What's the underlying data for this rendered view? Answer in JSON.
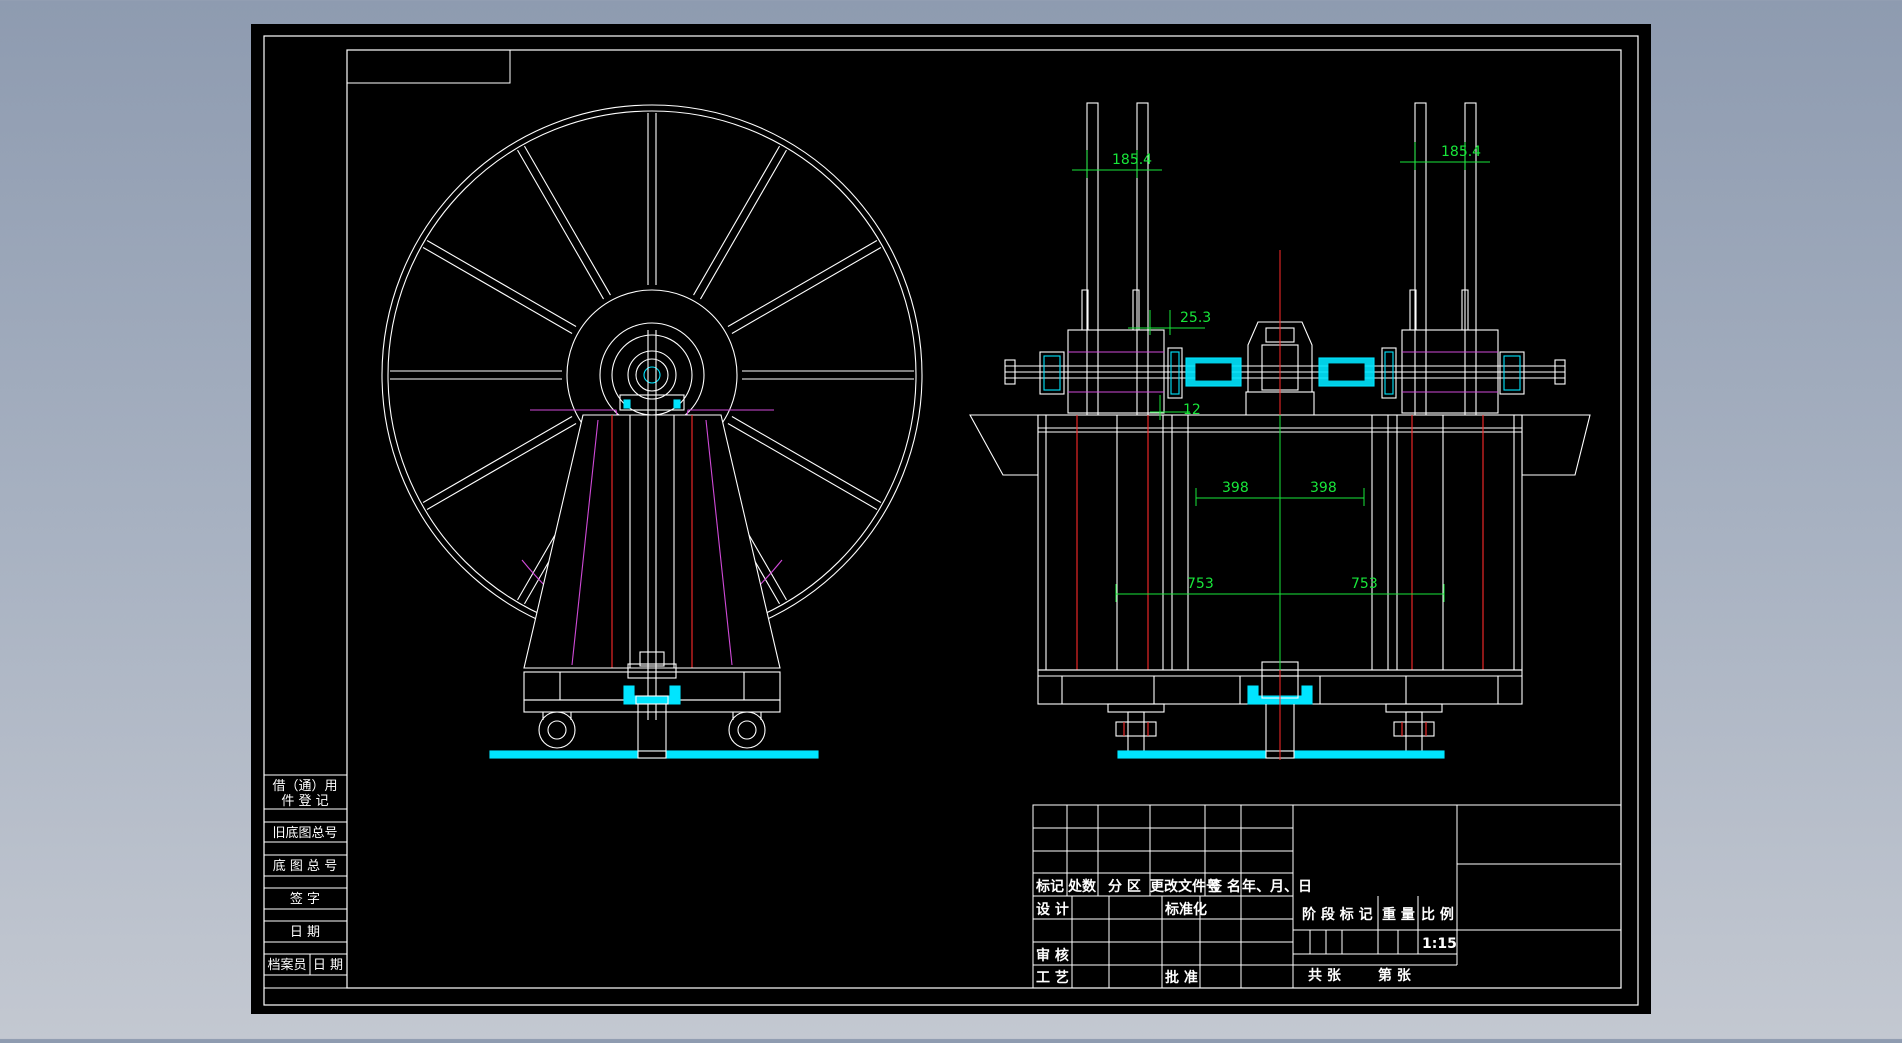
{
  "colors": {
    "background_outer": "#9aa6b8",
    "sheet": "#000000",
    "line": "#ffffff",
    "dimension": "#18e63a",
    "accent_cyan": "#00e5ff",
    "accent_magenta": "#d04ad8",
    "accent_red": "#ff2a2a"
  },
  "dimensions": {
    "gap_top_left": "185.4",
    "gap_top_right": "185.4",
    "bearing_gap": "25.3",
    "small_gap": "12",
    "half_width_left": "398",
    "half_width_right": "398",
    "span_left": "753",
    "span_right": "753"
  },
  "side_panel": {
    "items": [
      "借（通）用",
      "件 登 记",
      "旧底图总号",
      "底 图 总 号",
      "签  字",
      "日  期",
      "档案员",
      "日 期"
    ]
  },
  "title_block": {
    "headers": [
      "标记",
      "处数",
      "分 区",
      "更改文件号",
      "签 名",
      "年、月、日"
    ],
    "row_design": "设 计",
    "row_standard": "标准化",
    "row_review": "审 核",
    "row_process": "工 艺",
    "row_approve": "批 准",
    "stage_mark": "阶 段 标 记",
    "weight": "重 量",
    "scale_label": "比 例",
    "scale_value": "1:15",
    "sheet_total": "共   张",
    "sheet_num": "第   张"
  }
}
